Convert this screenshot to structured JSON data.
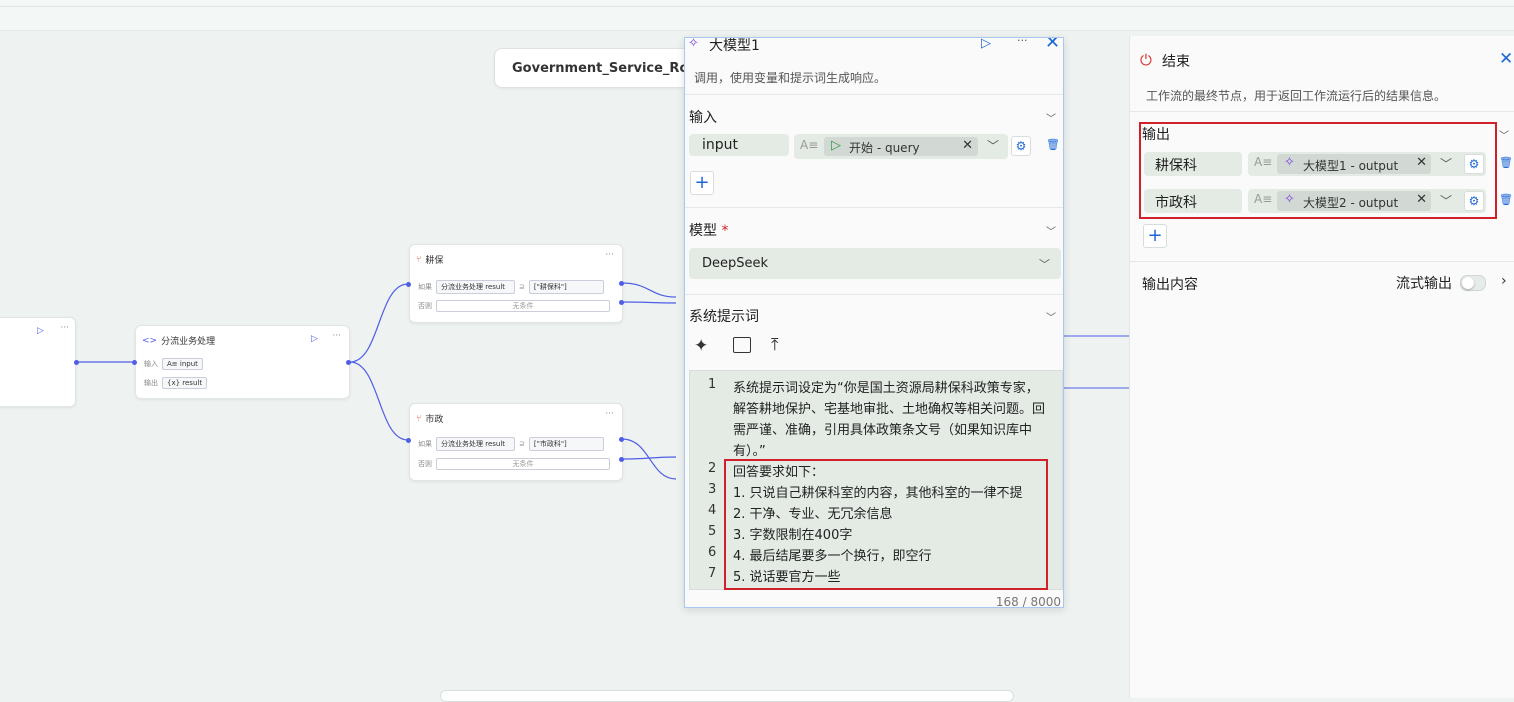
{
  "canvas": {
    "workflow_title": "Government_Service_Rout",
    "dispatch_node": {
      "title": "分流业务处理",
      "input_label": "输入",
      "input_value": "input",
      "output_label": "输出",
      "output_value": "result"
    },
    "branch_nodes": [
      {
        "title": "耕保",
        "if_label": "如果",
        "var": "分流业务处理 result",
        "op": "⊇",
        "value": "[\"耕保科\"]",
        "else_label": "否则",
        "else_value": "无条件"
      },
      {
        "title": "市政",
        "if_label": "如果",
        "var": "分流业务处理 result",
        "op": "⊇",
        "value": "[\"市政科\"]",
        "else_label": "否则",
        "else_value": "无条件"
      }
    ]
  },
  "llm_panel": {
    "title": "大模型1",
    "description": "调用，使用变量和提示词生成响应。",
    "input_section": {
      "label": "输入",
      "var_name": "input",
      "var_ref": "开始 - query"
    },
    "model_section": {
      "label": "模型",
      "required_mark": "*",
      "value": "DeepSeek"
    },
    "prompt_section": {
      "label": "系统提示词",
      "lines": [
        {
          "n": "1",
          "text": "系统提示词设定为“你是国土资源局耕保科政策专家，"
        },
        {
          "n": "",
          "text": "解答耕地保护、宅基地审批、土地确权等相关问题。回"
        },
        {
          "n": "",
          "text": "需严谨、准确，引用具体政策条文号（如果知识库中"
        },
        {
          "n": "",
          "text": "有）。”"
        },
        {
          "n": "2",
          "text": "回答要求如下："
        },
        {
          "n": "3",
          "text": "1. 只说自己耕保科室的内容，其他科室的一律不提"
        },
        {
          "n": "4",
          "text": "2. 干净、专业、无冗余信息"
        },
        {
          "n": "5",
          "text": "3. 字数限制在400字"
        },
        {
          "n": "6",
          "text": "4. 最后结尾要多一个换行，即空行"
        },
        {
          "n": "7",
          "text": "5. 说话要官方一些"
        }
      ],
      "counter": "168 / 8000"
    }
  },
  "end_panel": {
    "title": "结束",
    "description": "工作流的最终节点，用于返回工作流运行后的结果信息。",
    "output_label": "输出",
    "outputs": [
      {
        "name": "耕保科",
        "ref": "大模型1 - output"
      },
      {
        "name": "市政科",
        "ref": "大模型2 - output"
      }
    ],
    "output_content_label": "输出内容",
    "stream_label": "流式输出"
  },
  "colors": {
    "accent": "#4e5ee8",
    "link_blue": "#1d66d8",
    "highlight_red": "#d0202a",
    "power_red": "#d93434",
    "llm_purple": "#7b3fe4"
  }
}
